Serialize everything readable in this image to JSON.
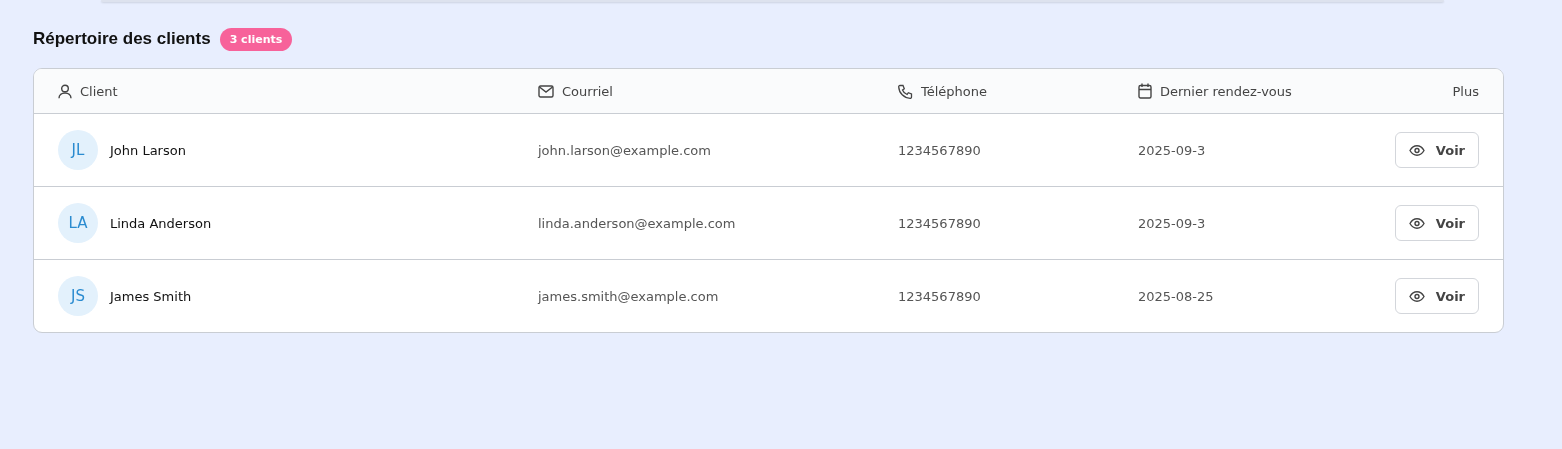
{
  "heading": {
    "title": "Répertoire des clients",
    "badge": "3 clients"
  },
  "table": {
    "columns": [
      {
        "label": "Client"
      },
      {
        "label": "Courriel"
      },
      {
        "label": "Téléphone"
      },
      {
        "label": "Dernier rendez-vous"
      },
      {
        "label": "Plus"
      }
    ],
    "rows": [
      {
        "initials": "JL",
        "name": "John Larson",
        "email": "john.larson@example.com",
        "phone": "1234567890",
        "last_visit": "2025-09-3",
        "action": "Voir"
      },
      {
        "initials": "LA",
        "name": "Linda Anderson",
        "email": "linda.anderson@example.com",
        "phone": "1234567890",
        "last_visit": "2025-09-3",
        "action": "Voir"
      },
      {
        "initials": "JS",
        "name": "James Smith",
        "email": "james.smith@example.com",
        "phone": "1234567890",
        "last_visit": "2025-08-25",
        "action": "Voir"
      }
    ]
  }
}
